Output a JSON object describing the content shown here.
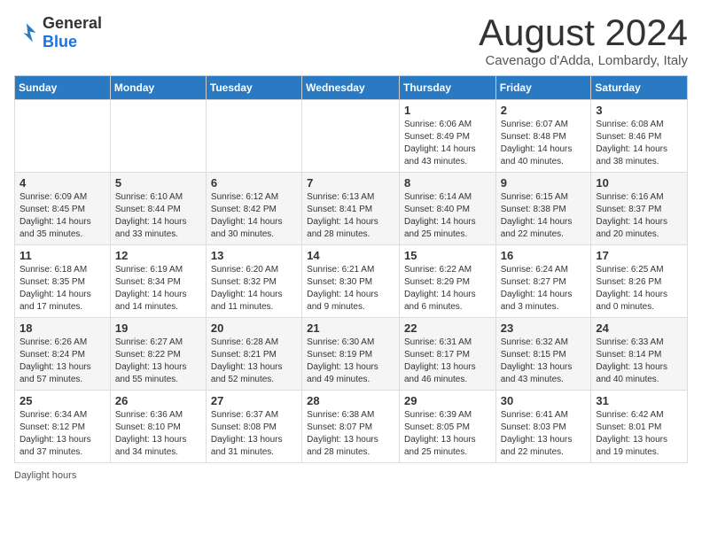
{
  "header": {
    "logo": {
      "general": "General",
      "blue": "Blue"
    },
    "title": "August 2024",
    "location": "Cavenago d'Adda, Lombardy, Italy"
  },
  "weekdays": [
    "Sunday",
    "Monday",
    "Tuesday",
    "Wednesday",
    "Thursday",
    "Friday",
    "Saturday"
  ],
  "weeks": [
    [
      {
        "day": "",
        "text": ""
      },
      {
        "day": "",
        "text": ""
      },
      {
        "day": "",
        "text": ""
      },
      {
        "day": "",
        "text": ""
      },
      {
        "day": "1",
        "text": "Sunrise: 6:06 AM\nSunset: 8:49 PM\nDaylight: 14 hours and 43 minutes."
      },
      {
        "day": "2",
        "text": "Sunrise: 6:07 AM\nSunset: 8:48 PM\nDaylight: 14 hours and 40 minutes."
      },
      {
        "day": "3",
        "text": "Sunrise: 6:08 AM\nSunset: 8:46 PM\nDaylight: 14 hours and 38 minutes."
      }
    ],
    [
      {
        "day": "4",
        "text": "Sunrise: 6:09 AM\nSunset: 8:45 PM\nDaylight: 14 hours and 35 minutes."
      },
      {
        "day": "5",
        "text": "Sunrise: 6:10 AM\nSunset: 8:44 PM\nDaylight: 14 hours and 33 minutes."
      },
      {
        "day": "6",
        "text": "Sunrise: 6:12 AM\nSunset: 8:42 PM\nDaylight: 14 hours and 30 minutes."
      },
      {
        "day": "7",
        "text": "Sunrise: 6:13 AM\nSunset: 8:41 PM\nDaylight: 14 hours and 28 minutes."
      },
      {
        "day": "8",
        "text": "Sunrise: 6:14 AM\nSunset: 8:40 PM\nDaylight: 14 hours and 25 minutes."
      },
      {
        "day": "9",
        "text": "Sunrise: 6:15 AM\nSunset: 8:38 PM\nDaylight: 14 hours and 22 minutes."
      },
      {
        "day": "10",
        "text": "Sunrise: 6:16 AM\nSunset: 8:37 PM\nDaylight: 14 hours and 20 minutes."
      }
    ],
    [
      {
        "day": "11",
        "text": "Sunrise: 6:18 AM\nSunset: 8:35 PM\nDaylight: 14 hours and 17 minutes."
      },
      {
        "day": "12",
        "text": "Sunrise: 6:19 AM\nSunset: 8:34 PM\nDaylight: 14 hours and 14 minutes."
      },
      {
        "day": "13",
        "text": "Sunrise: 6:20 AM\nSunset: 8:32 PM\nDaylight: 14 hours and 11 minutes."
      },
      {
        "day": "14",
        "text": "Sunrise: 6:21 AM\nSunset: 8:30 PM\nDaylight: 14 hours and 9 minutes."
      },
      {
        "day": "15",
        "text": "Sunrise: 6:22 AM\nSunset: 8:29 PM\nDaylight: 14 hours and 6 minutes."
      },
      {
        "day": "16",
        "text": "Sunrise: 6:24 AM\nSunset: 8:27 PM\nDaylight: 14 hours and 3 minutes."
      },
      {
        "day": "17",
        "text": "Sunrise: 6:25 AM\nSunset: 8:26 PM\nDaylight: 14 hours and 0 minutes."
      }
    ],
    [
      {
        "day": "18",
        "text": "Sunrise: 6:26 AM\nSunset: 8:24 PM\nDaylight: 13 hours and 57 minutes."
      },
      {
        "day": "19",
        "text": "Sunrise: 6:27 AM\nSunset: 8:22 PM\nDaylight: 13 hours and 55 minutes."
      },
      {
        "day": "20",
        "text": "Sunrise: 6:28 AM\nSunset: 8:21 PM\nDaylight: 13 hours and 52 minutes."
      },
      {
        "day": "21",
        "text": "Sunrise: 6:30 AM\nSunset: 8:19 PM\nDaylight: 13 hours and 49 minutes."
      },
      {
        "day": "22",
        "text": "Sunrise: 6:31 AM\nSunset: 8:17 PM\nDaylight: 13 hours and 46 minutes."
      },
      {
        "day": "23",
        "text": "Sunrise: 6:32 AM\nSunset: 8:15 PM\nDaylight: 13 hours and 43 minutes."
      },
      {
        "day": "24",
        "text": "Sunrise: 6:33 AM\nSunset: 8:14 PM\nDaylight: 13 hours and 40 minutes."
      }
    ],
    [
      {
        "day": "25",
        "text": "Sunrise: 6:34 AM\nSunset: 8:12 PM\nDaylight: 13 hours and 37 minutes."
      },
      {
        "day": "26",
        "text": "Sunrise: 6:36 AM\nSunset: 8:10 PM\nDaylight: 13 hours and 34 minutes."
      },
      {
        "day": "27",
        "text": "Sunrise: 6:37 AM\nSunset: 8:08 PM\nDaylight: 13 hours and 31 minutes."
      },
      {
        "day": "28",
        "text": "Sunrise: 6:38 AM\nSunset: 8:07 PM\nDaylight: 13 hours and 28 minutes."
      },
      {
        "day": "29",
        "text": "Sunrise: 6:39 AM\nSunset: 8:05 PM\nDaylight: 13 hours and 25 minutes."
      },
      {
        "day": "30",
        "text": "Sunrise: 6:41 AM\nSunset: 8:03 PM\nDaylight: 13 hours and 22 minutes."
      },
      {
        "day": "31",
        "text": "Sunrise: 6:42 AM\nSunset: 8:01 PM\nDaylight: 13 hours and 19 minutes."
      }
    ]
  ],
  "footer": "Daylight hours"
}
